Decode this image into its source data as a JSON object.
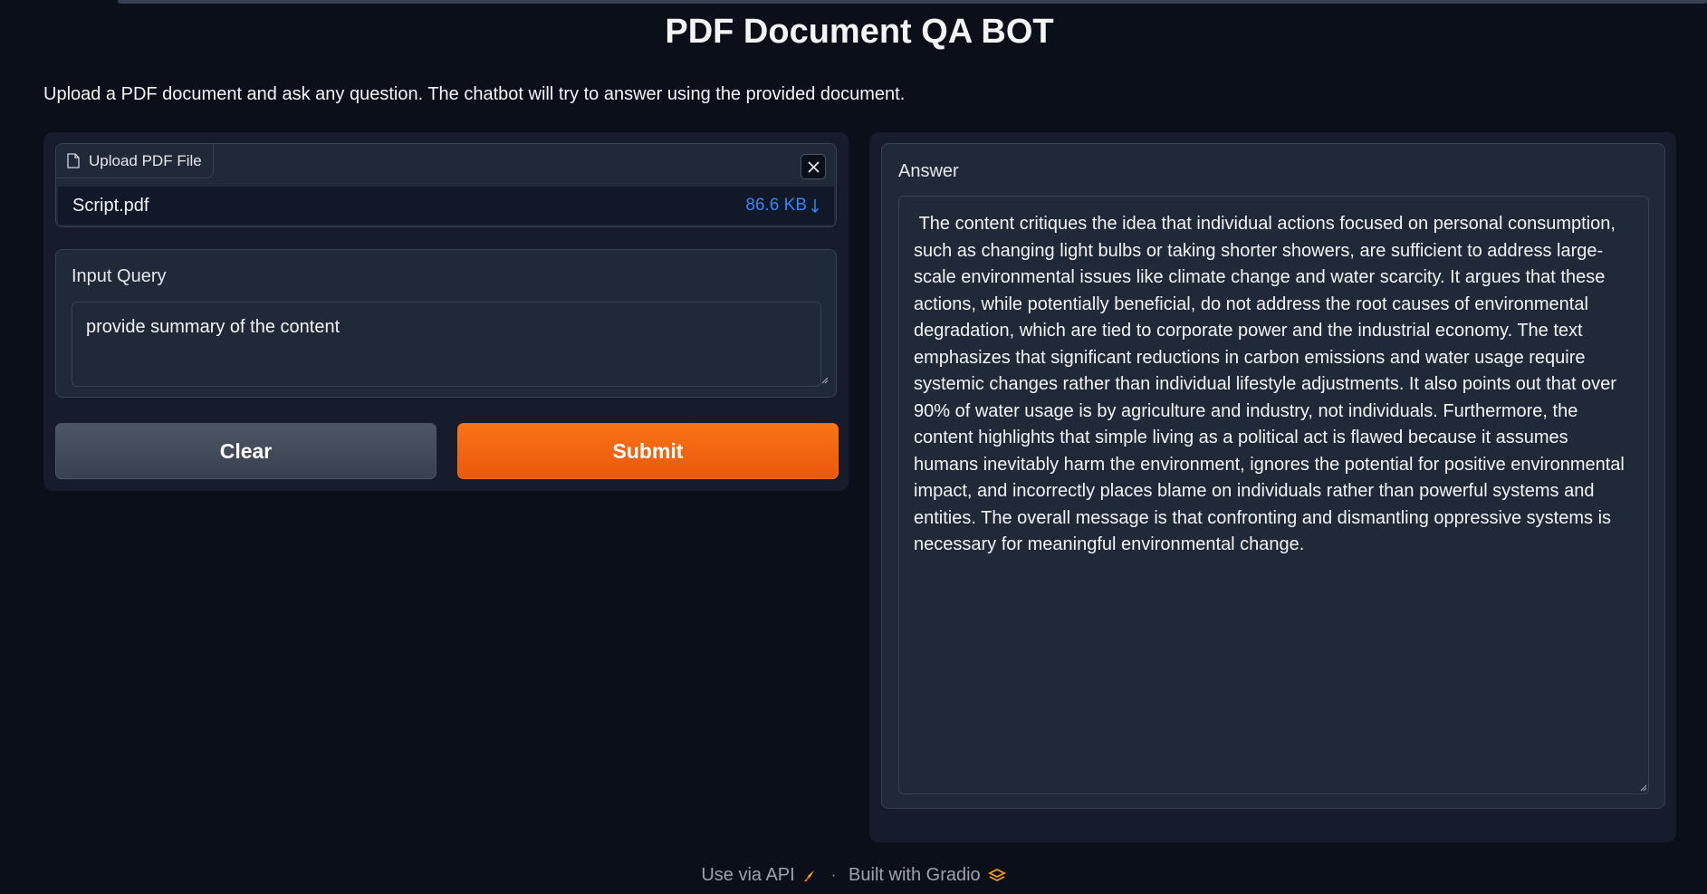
{
  "page": {
    "title": "PDF Document QA BOT",
    "description": "Upload a PDF document and ask any question. The chatbot will try to answer using the provided document."
  },
  "upload": {
    "label": "Upload PDF File",
    "file_name": "Script.pdf",
    "file_size": "86.6 KB"
  },
  "query": {
    "label": "Input Query",
    "value": "provide summary of the content"
  },
  "buttons": {
    "clear": "Clear",
    "submit": "Submit"
  },
  "answer": {
    "label": "Answer",
    "text": " The content critiques the idea that individual actions focused on personal consumption, such as changing light bulbs or taking shorter showers, are sufficient to address large-scale environmental issues like climate change and water scarcity. It argues that these actions, while potentially beneficial, do not address the root causes of environmental degradation, which are tied to corporate power and the industrial economy. The text emphasizes that significant reductions in carbon emissions and water usage require systemic changes rather than individual lifestyle adjustments. It also points out that over 90% of water usage is by agriculture and industry, not individuals. Furthermore, the content highlights that simple living as a political act is flawed because it assumes humans inevitably harm the environment, ignores the potential for positive environmental impact, and incorrectly places blame on individuals rather than powerful systems and entities. The overall message is that confronting and dismantling oppressive systems is necessary for meaningful environmental change."
  },
  "footer": {
    "api_link": "Use via API",
    "separator": "·",
    "built_with": "Built with Gradio"
  },
  "colors": {
    "background": "#0b0f19",
    "panel": "#1f2937",
    "accent": "#f97316",
    "link": "#3b82f6"
  }
}
